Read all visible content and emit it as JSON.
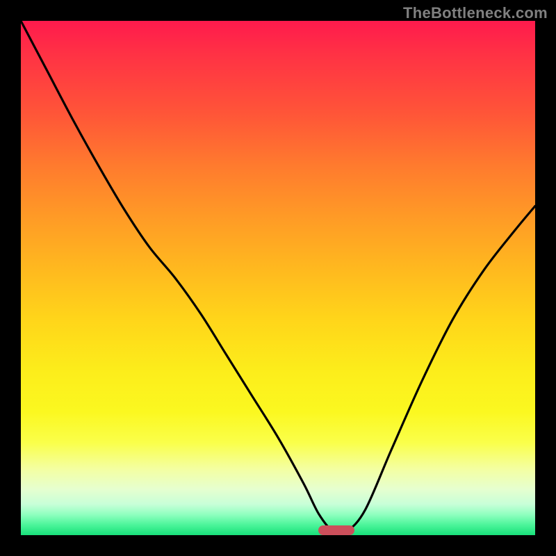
{
  "watermark_text": "TheBottleneck.com",
  "chart_data": {
    "type": "line",
    "title": "",
    "xlabel": "",
    "ylabel": "",
    "x_range": [
      0,
      1
    ],
    "y_range": [
      0,
      1
    ],
    "curve": {
      "x": [
        0.0,
        0.05,
        0.1,
        0.15,
        0.2,
        0.25,
        0.3,
        0.35,
        0.4,
        0.45,
        0.5,
        0.55,
        0.58,
        0.61,
        0.635,
        0.67,
        0.72,
        0.78,
        0.84,
        0.9,
        0.96,
        1.0
      ],
      "y": [
        1.0,
        0.905,
        0.81,
        0.72,
        0.635,
        0.56,
        0.5,
        0.43,
        0.35,
        0.27,
        0.19,
        0.1,
        0.04,
        0.005,
        0.008,
        0.05,
        0.165,
        0.3,
        0.42,
        0.515,
        0.592,
        0.64
      ]
    },
    "marker": {
      "x_start": 0.578,
      "x_end": 0.648,
      "y": 0.009,
      "color": "#cc4f5b"
    },
    "background_gradient": {
      "top_color": "#ff1a4d",
      "bottom_color": "#18e07a",
      "orientation": "vertical"
    }
  }
}
